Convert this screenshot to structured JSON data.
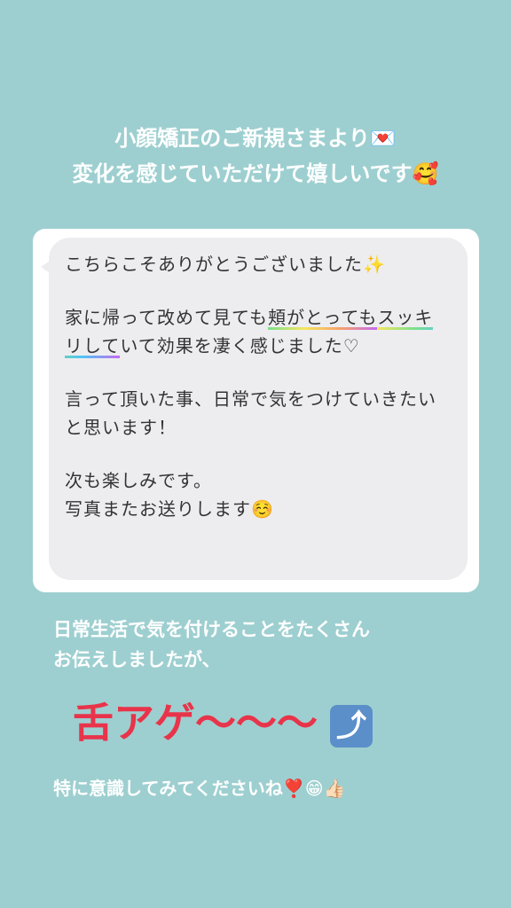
{
  "header": {
    "line1": "小顔矯正のご新規さまより💌",
    "line2": "変化を感じていただけて嬉しいです🥰"
  },
  "message": {
    "p1": "こちらこそありがとうございました✨",
    "p2_a": "家に帰って改めて見ても",
    "p2_hl1": "頬がとっても",
    "p2_b": "",
    "p2_hl2": "スッキリして",
    "p2_c": "いて効果を凄く感じました♡",
    "p3": "言って頂いた事、日常で気をつけていきたいと思います！",
    "p4_l1": "次も楽しみです。",
    "p4_l2": "写真またお送りします☺️"
  },
  "footer": {
    "line1": "日常生活で気を付けることをたくさん",
    "line2": "お伝えしましたが、",
    "big": "舌アゲ〜〜〜",
    "arrow_icon": "⤴",
    "line3": "特に意識してみてくださいね❣️😁👍🏻"
  },
  "colors": {
    "background": "#9ecfd0",
    "accent_red": "#e8344a",
    "bubble": "#ededf0"
  }
}
